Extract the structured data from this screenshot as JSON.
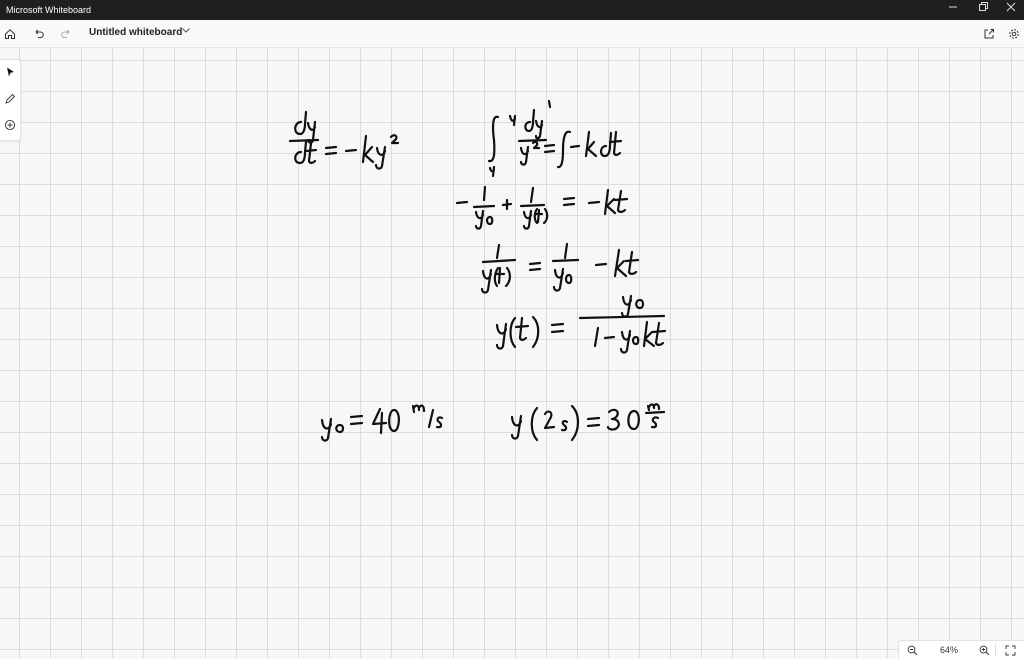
{
  "window": {
    "app_title": "Microsoft Whiteboard",
    "controls": [
      "minimize-icon",
      "restore-icon",
      "close-icon"
    ]
  },
  "toolbar": {
    "board_title": "Untitled whiteboard",
    "left_icons": [
      "home-icon",
      "undo-icon",
      "redo-icon"
    ],
    "right_icons": [
      "share-icon",
      "settings-icon"
    ]
  },
  "sidebar": {
    "tools": [
      "select-tool-icon",
      "pen-tool-icon",
      "add-tool-icon"
    ]
  },
  "ink": {
    "left_equation": "dy/dt = -ky^2",
    "integral": "∫_{y0}^{y} dy/y^2 = ∫ -k dt",
    "step1": "-1/y0 + 1/y(t) = -kt",
    "step2": "1/y(t) = 1/y0 - kt",
    "step3": "y(t) = y0/(1 - y0 k t)",
    "given1": "y0 = 40 m/s",
    "given2": "y(2s) = 30 m/s"
  },
  "zoom": {
    "level": "64%"
  }
}
